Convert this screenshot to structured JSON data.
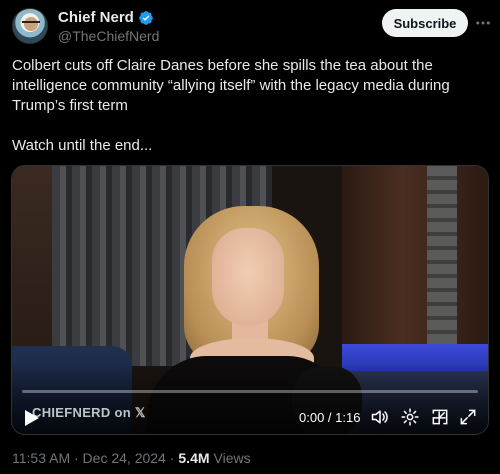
{
  "author": {
    "display_name": "Chief Nerd",
    "handle": "@TheChiefNerd",
    "verified": true,
    "avatar_icon": "avatar-illustration"
  },
  "actions": {
    "subscribe_label": "Subscribe",
    "more_icon": "more-icon"
  },
  "tweet": {
    "line1": "Colbert cuts off Claire Danes before she spills the tea about the",
    "line2": "intelligence community “allying itself” with the legacy media during",
    "line3": "Trump’s first term",
    "line4": "Watch until the end..."
  },
  "video": {
    "watermark": "CHIEFNERD on 𝕏",
    "time": "0:00 / 1:16",
    "progress": 0.0,
    "controls": [
      "play-icon",
      "volume-icon",
      "settings-icon",
      "pip-icon",
      "fullscreen-icon"
    ]
  },
  "meta": {
    "timestamp": "11:53 AM · Dec 24, 2024 ·",
    "views_count": "5.4M",
    "views_label": "Views"
  },
  "colors": {
    "background": "#000000",
    "text": "#e7e9ea",
    "muted": "#71767b",
    "verified": "#1d9bf0",
    "button_bg": "#eff3f4"
  }
}
